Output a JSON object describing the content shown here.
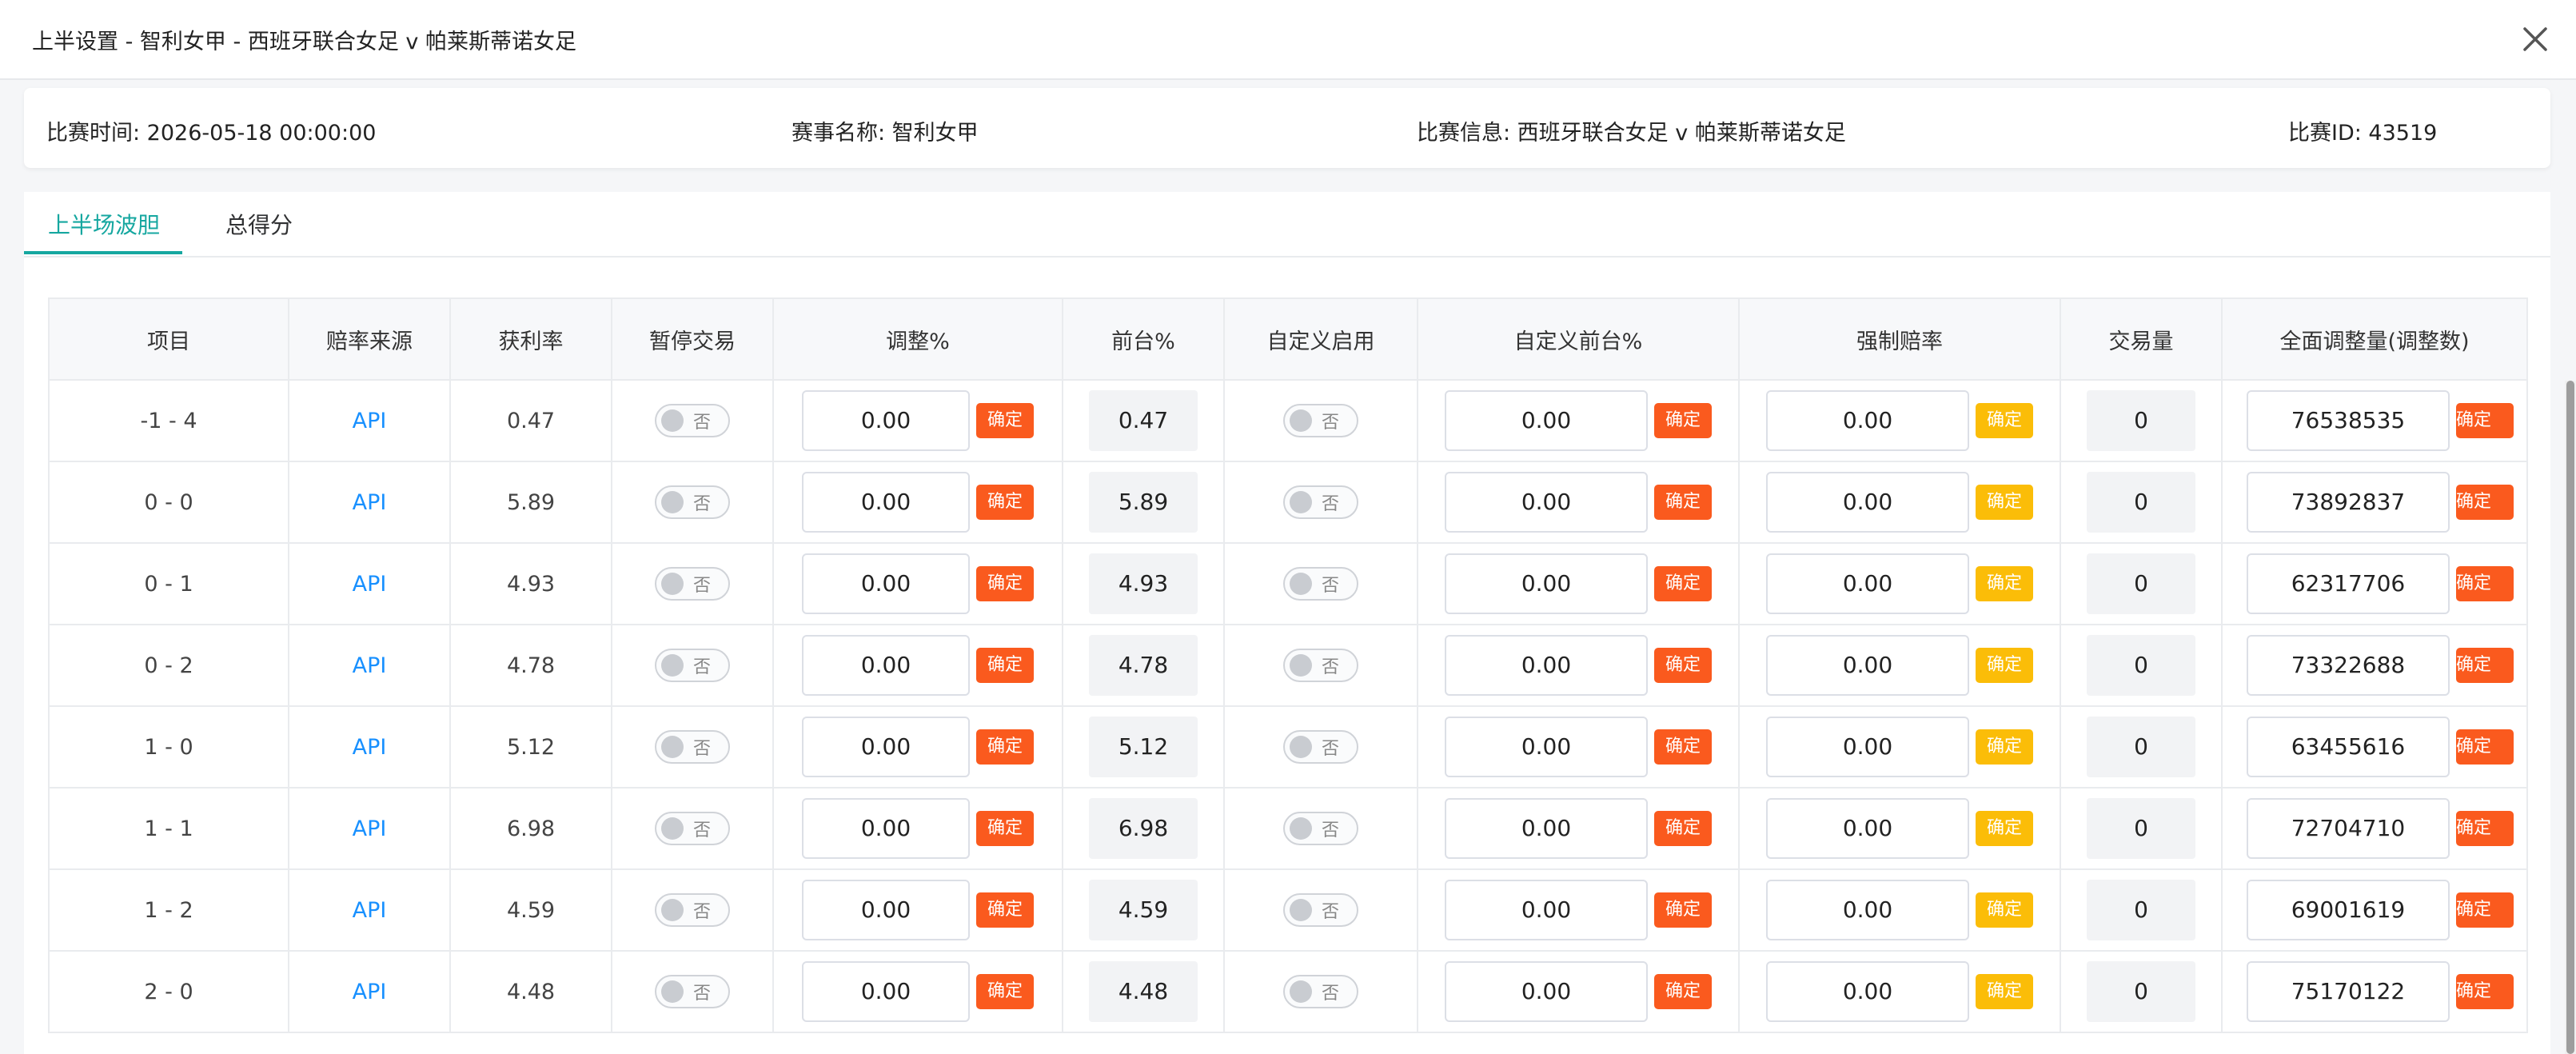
{
  "window": {
    "title": "上半设置 - 智利女甲 - 西班牙联合女足 v 帕莱斯蒂诺女足"
  },
  "info": {
    "time": "比赛时间: 2026-05-18 00:00:00",
    "league": "赛事名称: 智利女甲",
    "match": "比赛信息: 西班牙联合女足 v 帕莱斯蒂诺女足",
    "id": "比赛ID: 43519"
  },
  "tabs": [
    {
      "label": "上半场波胆",
      "active": true
    },
    {
      "label": "总得分",
      "active": false
    }
  ],
  "table": {
    "columns": [
      "项目",
      "赔率来源",
      "获利率",
      "暂停交易",
      "调整%",
      "前台%",
      "自定义启用",
      "自定义前台%",
      "强制赔率",
      "交易量",
      "全面调整量(调整数)"
    ],
    "switch_off_label": "否",
    "confirm_label": "确定",
    "rows": [
      {
        "item": "-1 - 4",
        "source": "API",
        "profit": "0.47",
        "adjust": "0.00",
        "front": "0.47",
        "custom_front": "0.00",
        "force": "0.00",
        "volume": "0",
        "total": "76538535"
      },
      {
        "item": "0 - 0",
        "source": "API",
        "profit": "5.89",
        "adjust": "0.00",
        "front": "5.89",
        "custom_front": "0.00",
        "force": "0.00",
        "volume": "0",
        "total": "73892837"
      },
      {
        "item": "0 - 1",
        "source": "API",
        "profit": "4.93",
        "adjust": "0.00",
        "front": "4.93",
        "custom_front": "0.00",
        "force": "0.00",
        "volume": "0",
        "total": "62317706"
      },
      {
        "item": "0 - 2",
        "source": "API",
        "profit": "4.78",
        "adjust": "0.00",
        "front": "4.78",
        "custom_front": "0.00",
        "force": "0.00",
        "volume": "0",
        "total": "73322688"
      },
      {
        "item": "1 - 0",
        "source": "API",
        "profit": "5.12",
        "adjust": "0.00",
        "front": "5.12",
        "custom_front": "0.00",
        "force": "0.00",
        "volume": "0",
        "total": "63455616"
      },
      {
        "item": "1 - 1",
        "source": "API",
        "profit": "6.98",
        "adjust": "0.00",
        "front": "6.98",
        "custom_front": "0.00",
        "force": "0.00",
        "volume": "0",
        "total": "72704710"
      },
      {
        "item": "1 - 2",
        "source": "API",
        "profit": "4.59",
        "adjust": "0.00",
        "front": "4.59",
        "custom_front": "0.00",
        "force": "0.00",
        "volume": "0",
        "total": "69001619"
      },
      {
        "item": "2 - 0",
        "source": "API",
        "profit": "4.48",
        "adjust": "0.00",
        "front": "4.48",
        "custom_front": "0.00",
        "force": "0.00",
        "volume": "0",
        "total": "75170122"
      }
    ]
  },
  "colors": {
    "accent": "#16a7a0",
    "confirm_red": "#fa5a1e",
    "confirm_yellow": "#fbbd08",
    "link": "#1890ff"
  }
}
